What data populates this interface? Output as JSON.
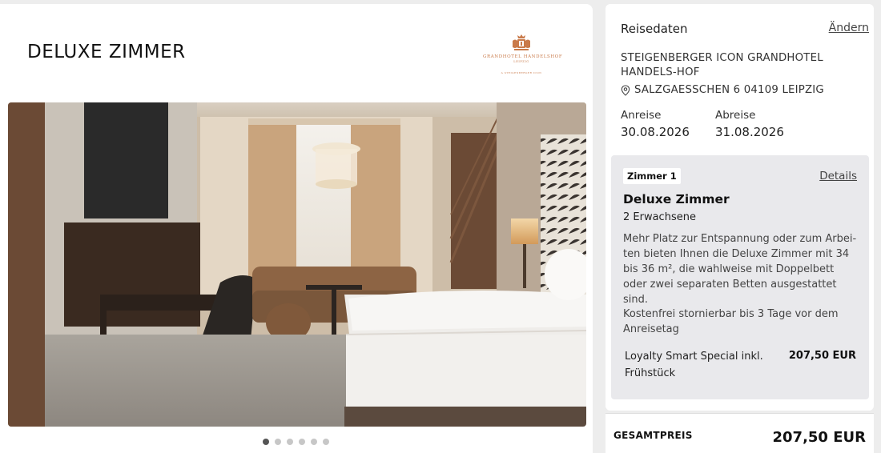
{
  "room": {
    "title": "DELUXE ZIMMER",
    "photo_alt": "Deluxe Zimmer",
    "carousel": {
      "count": 6,
      "active": 0
    }
  },
  "logo": {
    "name": "GRANDHOTEL HANDELSHOF",
    "sub": "LEIPZIG",
    "tagline": "A STEIGENBERGER ICON",
    "color": "#c97a4a"
  },
  "booking": {
    "section_title": "Reisedaten",
    "change_label": "Ändern",
    "hotel_name": "STEIGENBERGER ICON GRANDHOTEL HANDELS-HOF",
    "address": "SALZGAESSCHEN 6 04109 LEIPZIG",
    "arrival_label": "Anreise",
    "arrival_date": "30.08.2026",
    "departure_label": "Abreise",
    "departure_date": "31.08.2026"
  },
  "room_summary": {
    "badge": "Zimmer 1",
    "details_label": "Details",
    "title": "Deluxe Zimmer",
    "guests": "2 Erwachsene",
    "description": "Mehr Platz zur Entspannung oder zum Arbei-ten bieten Ihnen die Deluxe Zimmer mit 34 bis 36 m², die wahlweise mit Doppelbett oder zwei separaten Betten ausgestattet sind.",
    "cancellation": "Kostenfrei stornierbar bis 3 Tage vor dem Anreisetag",
    "rate_name": "Loyalty Smart Special inkl. Frühstück",
    "rate_price": "207,50 EUR"
  },
  "total": {
    "label": "GESAMTPREIS",
    "value": "207,50 EUR"
  },
  "icons": {
    "location": "map-pin-icon"
  },
  "colors": {
    "background": "#ededed",
    "card": "#ffffff",
    "room_box": "#e9e9ec",
    "logo": "#c97a4a"
  }
}
